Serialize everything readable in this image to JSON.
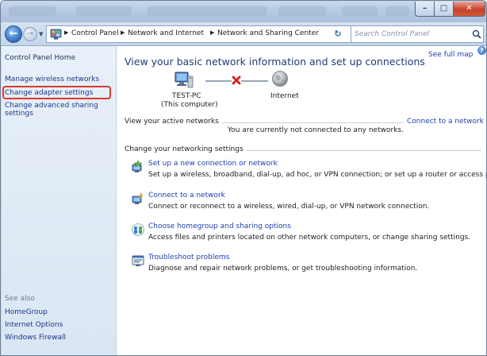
{
  "window": {
    "controls": {
      "minimize": "–",
      "maximize": "□",
      "close": "✕"
    }
  },
  "navigation": {
    "back_glyph": "←",
    "forward_glyph": "→",
    "breadcrumbs": [
      "Control Panel",
      "Network and Internet",
      "Network and Sharing Center"
    ],
    "refresh_glyph": "↻",
    "search_placeholder": "Search Control Panel"
  },
  "sidebar": {
    "home": "Control Panel Home",
    "links": [
      "Manage wireless networks",
      "Change adapter settings",
      "Change advanced sharing settings"
    ],
    "highlighted_link": "Change adapter settings",
    "see_also_heading": "See also",
    "see_also_links": [
      "HomeGroup",
      "Internet Options",
      "Windows Firewall"
    ]
  },
  "main": {
    "help_glyph": "?",
    "title": "View your basic network information and set up connections",
    "see_full_map": "See full map",
    "map": {
      "computer_name": "TEST-PC",
      "computer_sub": "(This computer)",
      "internet_label": "Internet",
      "connection_status_icon": "red-x-icon"
    },
    "active_networks": {
      "heading": "View your active networks",
      "connect_link": "Connect to a network",
      "status": "You are currently not connected to any networks."
    },
    "settings": {
      "heading": "Change your networking settings",
      "tasks": [
        {
          "icon": "new-connection-icon",
          "link": "Set up a new connection or network",
          "description": "Set up a wireless, broadband, dial-up, ad hoc, or VPN connection; or set up a router or access point."
        },
        {
          "icon": "connect-network-icon",
          "link": "Connect to a network",
          "description": "Connect or reconnect to a wireless, wired, dial-up, or VPN network connection."
        },
        {
          "icon": "homegroup-icon",
          "link": "Choose homegroup and sharing options",
          "description": "Access files and printers located on other network computers, or change sharing settings."
        },
        {
          "icon": "troubleshoot-icon",
          "link": "Troubleshoot problems",
          "description": "Diagnose and repair network problems, or get troubleshooting information."
        }
      ]
    }
  },
  "colors": {
    "link": "#1e3fae",
    "highlight_border": "#d93a2b",
    "sidebar_bg": "#dae6f3"
  }
}
